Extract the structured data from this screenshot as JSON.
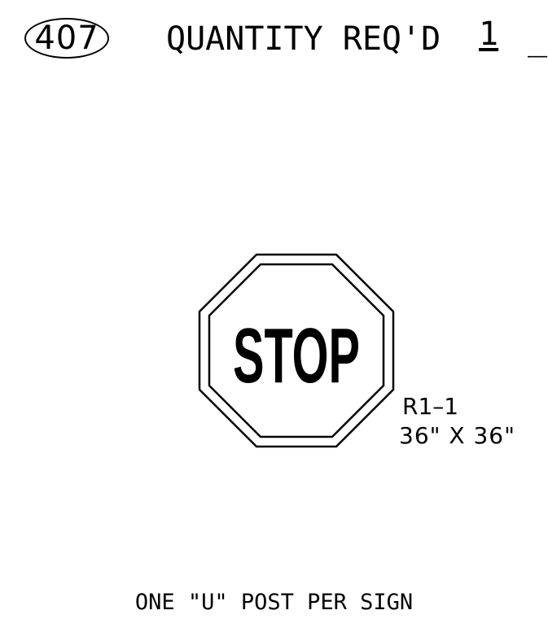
{
  "header": {
    "item_number": "407",
    "quantity_label": "QUANTITY REQ'D",
    "quantity_value": "1",
    "quantity_blank": "_"
  },
  "sign": {
    "legend": "STOP",
    "code": "R1–1",
    "size": "36\" X 36\"",
    "shape": "octagon",
    "border_color": "#000000",
    "background_color": "#ffffff"
  },
  "note": {
    "text": "ONE \"U\" POST PER SIGN"
  }
}
